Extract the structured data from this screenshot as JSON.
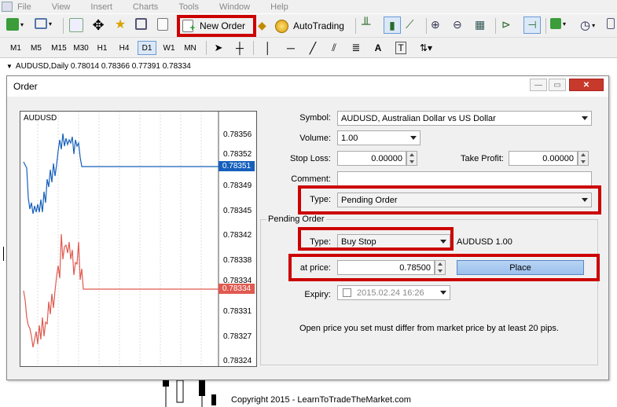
{
  "menu": [
    "File",
    "View",
    "Insert",
    "Charts",
    "Tools",
    "Window",
    "Help"
  ],
  "toolbar": {
    "new_order": "New Order",
    "autotrading": "AutoTrading"
  },
  "timeframes": [
    "M1",
    "M5",
    "M15",
    "M30",
    "H1",
    "H4",
    "D1",
    "W1",
    "MN"
  ],
  "active_timeframe": "D1",
  "chart_header": "AUDUSD,Daily  0.78014 0.78366 0.77391 0.78334",
  "dialog": {
    "title": "Order",
    "chart": {
      "symbol": "AUDUSD",
      "ask_label": "0.78351",
      "bid_label": "0.78334",
      "price_ticks": [
        "0.78356",
        "0.78352",
        "0.78349",
        "0.78345",
        "0.78342",
        "0.78338",
        "0.78334",
        "0.78331",
        "0.78327",
        "0.78324"
      ]
    },
    "symbol_label": "Symbol:",
    "symbol_value": "AUDUSD, Australian Dollar vs US Dollar",
    "volume_label": "Volume:",
    "volume_value": "1.00",
    "stop_loss_label": "Stop Loss:",
    "stop_loss_value": "0.00000",
    "take_profit_label": "Take Profit:",
    "take_profit_value": "0.00000",
    "comment_label": "Comment:",
    "comment_value": "",
    "type_label": "Type:",
    "type_value": "Pending Order",
    "pending": {
      "group_title": "Pending Order",
      "type_label": "Type:",
      "type_value": "Buy Stop",
      "summary": "AUDUSD 1.00",
      "price_label": "at price:",
      "price_value": "0.78500",
      "place_label": "Place",
      "expiry_label": "Expiry:",
      "expiry_value": "2015.02.24 16:26",
      "note": "Open price you set must differ from market price by at least 20 pips."
    }
  },
  "copyright": "Copyright 2015 - LearnToTradeTheMarket.com",
  "colors": {
    "highlight": "#cc0000",
    "ask_line": "#1560bd",
    "bid_line": "#e05a50",
    "place_button": "#9cc0ec"
  }
}
